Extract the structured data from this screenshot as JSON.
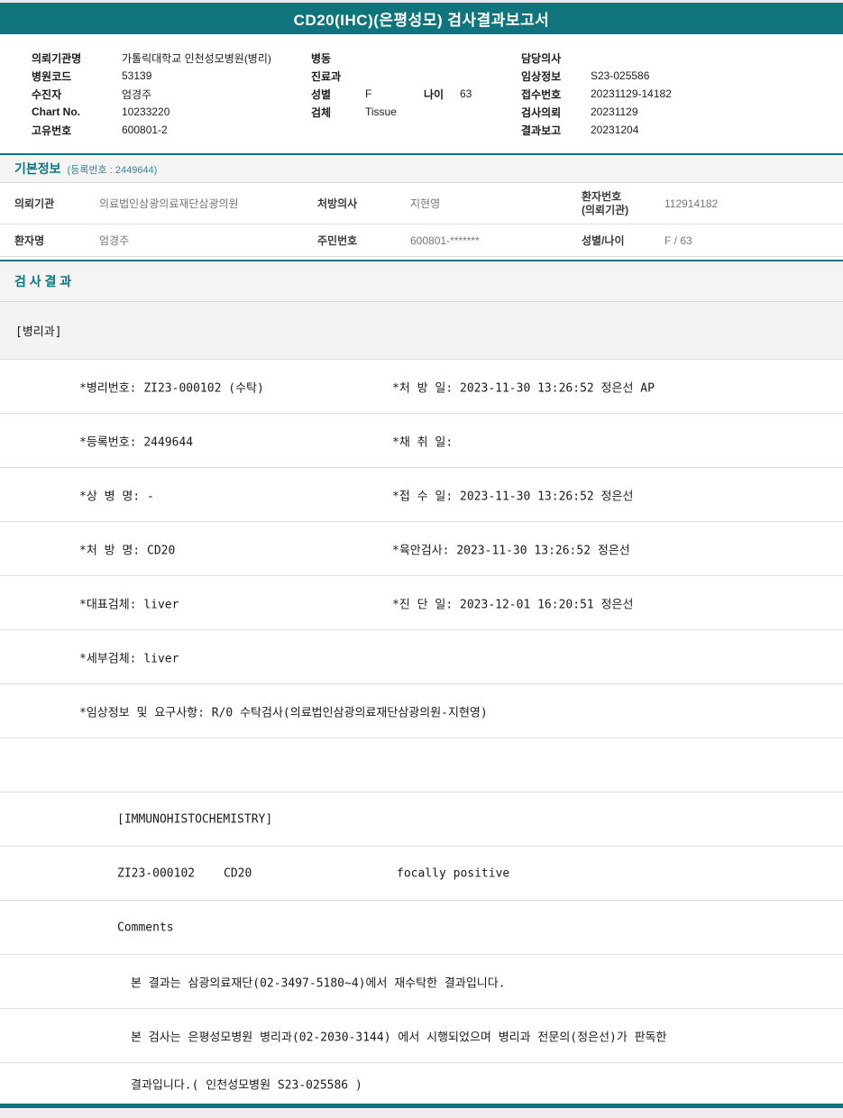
{
  "colors": {
    "accent_teal": "#0f747c"
  },
  "title": "CD20(IHC)(은평성모) 검사결과보고서",
  "header": {
    "left": [
      {
        "label": "의뢰기관명",
        "value": "가톨릭대학교 인천성모병원(병리)"
      },
      {
        "label": "병원코드",
        "value": "53139"
      },
      {
        "label": "수진자",
        "value": "엄경주"
      },
      {
        "label": "Chart No.",
        "value": "10233220"
      },
      {
        "label": "고유번호",
        "value": "600801-2"
      }
    ],
    "middle": [
      {
        "label": "병동",
        "value": ""
      },
      {
        "label": "진료과",
        "value": ""
      },
      {
        "label": "성별",
        "value": "F",
        "label2": "나이",
        "value2": "63"
      },
      {
        "label": "검체",
        "value": "Tissue"
      }
    ],
    "right": [
      {
        "label": "담당의사",
        "value": ""
      },
      {
        "label": "임상정보",
        "value": "S23-025586"
      },
      {
        "label": "접수번호",
        "value": "20231129-14182"
      },
      {
        "label": "검사의뢰",
        "value": "20231129"
      },
      {
        "label": "결과보고",
        "value": "20231204"
      }
    ]
  },
  "basic_info": {
    "section_title": "기본정보",
    "reg_note": "(등록번호 : 2449644)",
    "row1": {
      "label1": "의뢰기관",
      "value1": "의료법인삼광의료재단삼광의원",
      "label2": "처방의사",
      "value2": "지현영",
      "label3a": "환자번호",
      "label3b": "(의뢰기관)",
      "value3": "112914182"
    },
    "row2": {
      "label1": "환자명",
      "value1": "엄경주",
      "label2": "주민번호",
      "value2": "600801-*******",
      "label3": "성별/나이",
      "value3": "F / 63"
    }
  },
  "results": {
    "section_title": "검 사 결 과",
    "dept": "[병리과]",
    "detail_rows": [
      {
        "left": "*병리번호: ZI23-000102 (수탁)",
        "right": "*처 방 일: 2023-11-30 13:26:52  정은선 AP"
      },
      {
        "left": "*등록번호: 2449644",
        "right": "*채 취 일:"
      },
      {
        "left": "*상 병 명: -",
        "right": "*접 수 일: 2023-11-30 13:26:52  정은선"
      },
      {
        "left": "*처 방 명: CD20",
        "right": "*육안검사: 2023-11-30 13:26:52  정은선"
      },
      {
        "left": "*대표검체: liver",
        "right": "*진 단 일: 2023-12-01 16:20:51  정은선"
      },
      {
        "left": "*세부검체: liver",
        "right": ""
      },
      {
        "left": "*임상정보 및 요구사항: R/0 수탁검사(의료법인삼광의료재단삼광의원-지현영)",
        "right": ""
      }
    ],
    "ihc_header": "[IMMUNOHISTOCHEMISTRY]",
    "result_line": {
      "code": "ZI23-000102",
      "test": "CD20",
      "value": "focally positive"
    },
    "comments_label": "Comments",
    "comments": [
      "본 결과는 삼광의료재단(02-3497-5180~4)에서 재수탁한 결과입니다.",
      "본 검사는 은평성모병원 병리과(02-2030-3144) 에서 시행되었으며 병리과 전문의(정은선)가 판독한",
      "결과입니다.( 인천성모병원 S23-025586 )"
    ]
  }
}
